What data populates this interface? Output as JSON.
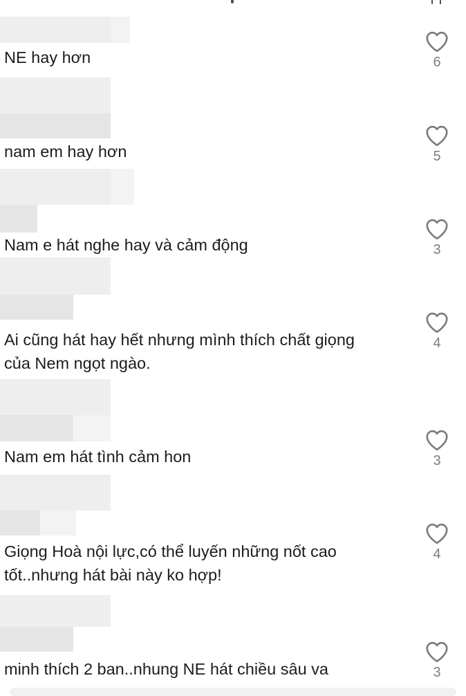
{
  "comments": [
    {
      "text": "NE hay hơn",
      "likes": "6"
    },
    {
      "text": "nam em hay hơn",
      "likes": "5"
    },
    {
      "text": "Nam e hát nghe hay và cảm động",
      "likes": "3"
    },
    {
      "text": "Ai cũng hát hay hết nhưng mình thích chất giọng\ncủa Nem ngọt ngào.",
      "likes": "4"
    },
    {
      "text": "Nam em hát tình cảm hon",
      "likes": "3"
    },
    {
      "text": "Giọng Hoà nội lực,có thể luyến những nốt cao\ntốt..nhưng hát bài này ko hợp!",
      "likes": "4"
    },
    {
      "text": "minh thích 2 ban..nhung NE hát chiều sâu va",
      "likes": "3"
    }
  ],
  "icons": {
    "like": "heart-outline-icon"
  },
  "colors": {
    "text": "#1c1c1c",
    "like_count": "#7d7d7d",
    "icon_stroke": "#7a7a7a",
    "redacted_block": "#eeeeee",
    "background": "#ffffff"
  }
}
